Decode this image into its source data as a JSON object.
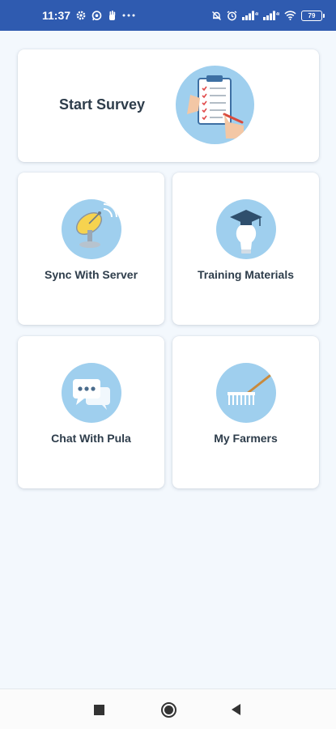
{
  "status_bar": {
    "time": "11:37",
    "left_icons": [
      "gear-icon",
      "whatsapp-icon",
      "hand-icon",
      "more-icon"
    ],
    "right_icons": [
      "mute-bell-icon",
      "alarm-icon",
      "signal-icon",
      "signal-icon",
      "wifi-icon"
    ],
    "battery": "79"
  },
  "menu": {
    "start_survey": {
      "label": "Start Survey",
      "icon": "clipboard-checklist-icon"
    },
    "sync": {
      "label": "Sync With Server",
      "icon": "satellite-dish-icon"
    },
    "training": {
      "label": "Training Materials",
      "icon": "graduation-bulb-icon"
    },
    "chat": {
      "label": "Chat With Pula",
      "icon": "chat-bubbles-icon"
    },
    "farmers": {
      "label": "My Farmers",
      "icon": "rake-icon"
    }
  },
  "nav": {
    "items": [
      "recents-button",
      "home-button",
      "back-button"
    ]
  },
  "colors": {
    "status_bar": "#2f5bb0",
    "icon_circle": "#9fcfee",
    "background": "#f3f8fd",
    "label_text": "#2e3d4b"
  }
}
